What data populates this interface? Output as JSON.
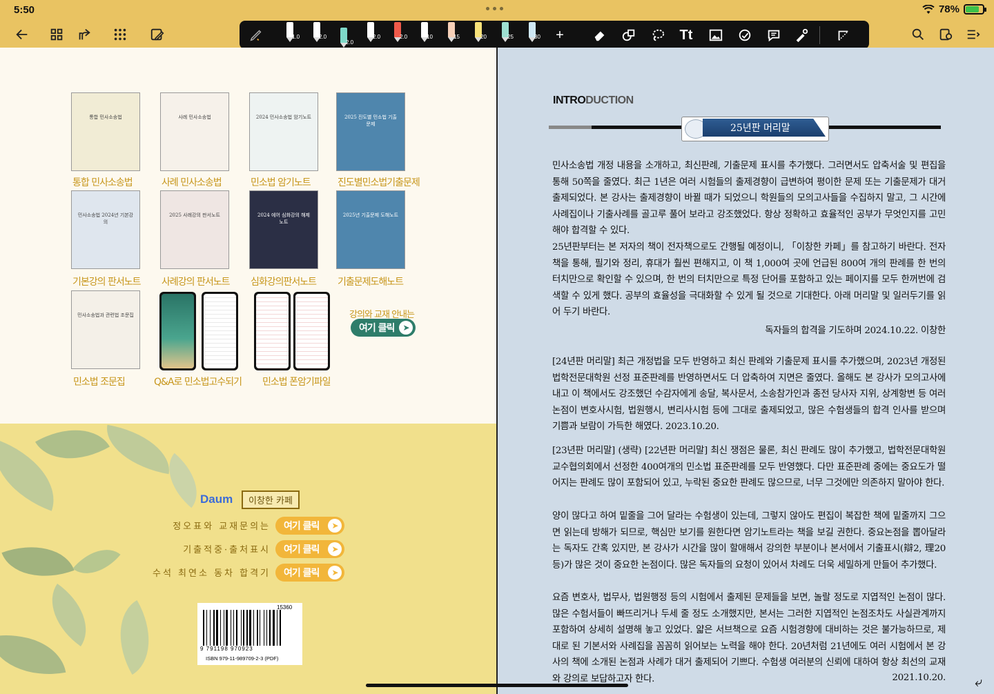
{
  "status": {
    "time": "5:50",
    "battery": "78%",
    "battery_level": 0.78
  },
  "toolbar": {
    "pens": [
      {
        "label": "1.0",
        "color": "#ffffff"
      },
      {
        "label": "2.0",
        "color": "#ffffff"
      },
      {
        "label": "2.0",
        "color": "#7ed8c8"
      },
      {
        "label": "2.0",
        "color": "#ffffff"
      },
      {
        "label": "2.0",
        "color": "#f05a4a"
      },
      {
        "label": "10",
        "color": "#ffffff"
      },
      {
        "label": "15",
        "color": "#f6d0b8"
      },
      {
        "label": "20",
        "color": "#f7e27a"
      },
      {
        "label": "25",
        "color": "#9ee0d2"
      },
      {
        "label": "30",
        "color": "#cfe8f5"
      }
    ],
    "text_tool": "Tt"
  },
  "left": {
    "books_row1": [
      {
        "title": "통합 민사소송법",
        "caption": "통합 민사소송법",
        "cover": "#f1ecd5"
      },
      {
        "title": "사례 민사소송법",
        "caption": "사례 민사소송법",
        "cover": "#f6f1ea"
      },
      {
        "title": "2024 민사소송법 암기노트",
        "caption": "민소법 암기노트",
        "cover": "#eef3f2"
      },
      {
        "title": "2025 진도별 민소법 기출문제",
        "caption": "진도별민소법기출문제",
        "cover": "#4f86ad"
      }
    ],
    "books_row2": [
      {
        "title": "민사소송법 2024년 기본강의",
        "caption": "기본강의 판서노트",
        "cover": "#dfe6ee"
      },
      {
        "title": "2025 사례강의 판서노트",
        "caption": "사례강의 판서노트",
        "cover": "#efe6e3"
      },
      {
        "title": "2024 에어 심화강의 해제노트",
        "caption": "심화강의판서노트",
        "cover": "#2b2f45"
      },
      {
        "title": "2025년 기출문제 도해노트",
        "caption": "기출문제도해노트",
        "cover": "#4f86ad"
      }
    ],
    "book_row3": {
      "title": "민사소송법과 관련법 조문집",
      "caption": "민소법 조문집",
      "cover": "#f3f0f5"
    },
    "caption_qa": "Q&A로 민소법고수되기",
    "caption_summary": "민소법 폰암기파일",
    "guide_text": "강의와 교재 안내는",
    "click_label": "여기 클릭",
    "cafe_logo": "Daum",
    "cafe_name": "이창한 카페",
    "links": [
      {
        "text": "정오표와 교재문의는",
        "button": "여기 클릭"
      },
      {
        "text": "기출적중·출처표시",
        "button": "여기 클릭"
      },
      {
        "text": "수석 최연소 동차 합격기",
        "button": "여기 클릭"
      }
    ],
    "barcode": {
      "price_code": "15360",
      "digits": "9 791198 970923",
      "isbn": "ISBN 979-11-989709-2-3 (PDF)"
    }
  },
  "right": {
    "heading_bold": "INTRO",
    "heading_light": "DUCTION",
    "banner": "25년판 머리말",
    "paragraphs": [
      "민사소송법 개정 내용을 소개하고, 최신판례, 기출문제 표시를 추가했다. 그러면서도 압축서술 및 편집을 통해 50쪽을 줄였다. 최근 1년은 여러 시험들의 출제경향이 급변하여 평이한 문제 또는 기출문제가 대거 출제되었다. 본 강사는 출제경향이 바뀔 때가 되었으니 학원들의 모의고사들을 수집하지 말고, 그 시간에 사례집이나 기출사례를 골고루 풀어 보라고 강조했었다. 항상 정확하고 효율적인 공부가 무엇인지를 고민해야 합격할 수 있다.",
      "25년판부터는 본 저자의 책이 전자책으로도 간행될 예정이니, 「이창한 카페」를 참고하기 바란다. 전자책을 통해, 필기와 정리, 휴대가 훨씬 편해지고, 이 책 1,000여 곳에 언급된 800여 개의 판례를 한 번의 터치만으로 확인할 수 있으며, 한 번의 터치만으로 특정 단어를 포함하고 있는 페이지를 모두 한꺼번에 검색할 수 있게 했다. 공부의 효율성을 극대화할 수 있게 될 것으로 기대한다. 아래 머리말 및 일러두기를 읽어 두기 바란다."
    ],
    "signature_25": "독자들의 합격을 기도하며   2024.10.22. 이창한",
    "para_24": "[24년판 머리말] 최근 개정법을 모두 반영하고 최신 판례와 기출문제 표시를 추가했으며, 2023년 개정된 법학전문대학원 선정 표준판례를 반영하면서도 더 압축하여 지면은 줄였다. 올해도 본 강사가 모의고사에 내고 이 책에서도 강조했던 수감자에게 송달, 복사문서, 소송참가인과 종전 당사자 지위, 상계항변 등 여러 논점이 변호사시험, 법원행시, 변리사시험 등에 그대로 출제되었고, 많은 수험생들의 합격 인사를 받으며 기쁨과 보람이 가득한 해였다.     2023.10.20.",
    "para_23": "[23년판 머리말] (생략)  [22년판 머리말] 최신 쟁점은 물론, 최신 판례도 많이 추가했고, 법학전문대학원 교수협의회에서 선정한 400여개의 민소법 표준판례를 모두 반영했다. 다만 표준판례 중에는 중요도가 떨어지는 판례도 많이 포함되어 있고, 누락된 중요한 판례도 많으므로, 너무 그것에만 의존하지 말아야 한다.",
    "para_notes": "양이 많다고 하여 밑줄을 그어 달라는 수험생이 있는데, 그렇지 않아도 편집이 복잡한 책에 밑줄까지 그으면 읽는데 방해가 되므로, 핵심만 보기를 원한다면 암기노트라는 책을 보길 권한다. 중요논점을 뽑아달라는 독자도 간혹 있지만, 본 강사가 시간을 많이 할애해서 강의한 부분이나 본서에서 기출표시(辯2, 理20 등)가 많은 것이 중요한 논점이다. 많은 독자들의 요청이 있어서 차례도 더욱 세밀하게 만들어 추가했다.",
    "para_last": "요즘 변호사, 법무사, 법원행정 등의 시험에서 출제된 문제들을 보면, 놀랄 정도로 지엽적인 논점이 많다. 많은 수험서들이 빠뜨리거나 두세 줄 정도 소개했지만, 본서는 그러한 지엽적인 논점조차도 사실관계까지 포함하여 상세히 설명해 놓고 있었다. 얇은 서브책으로 요즘 시험경향에 대비하는 것은 불가능하므로, 제대로 된 기본서와 사례집을 꼼꼼히 읽어보는 노력을 해야 한다. 20년처럼 21년에도 여러 시험에서 본 강사의 책에 소개된 논점과 사례가 대거 출제되어 기쁘다. 수험생 여러분의 신뢰에 대하여 항상 최선의 교재와 강의로 보답하고자 한다.",
    "signature_21": "2021.10.20."
  },
  "colors": {
    "topbar": "#e9c362",
    "left_page": "#fdf9ef",
    "right_page": "#cfdbe7",
    "caption": "#c7961b",
    "button": "#f2b63a",
    "banner": "#2f5d93"
  }
}
